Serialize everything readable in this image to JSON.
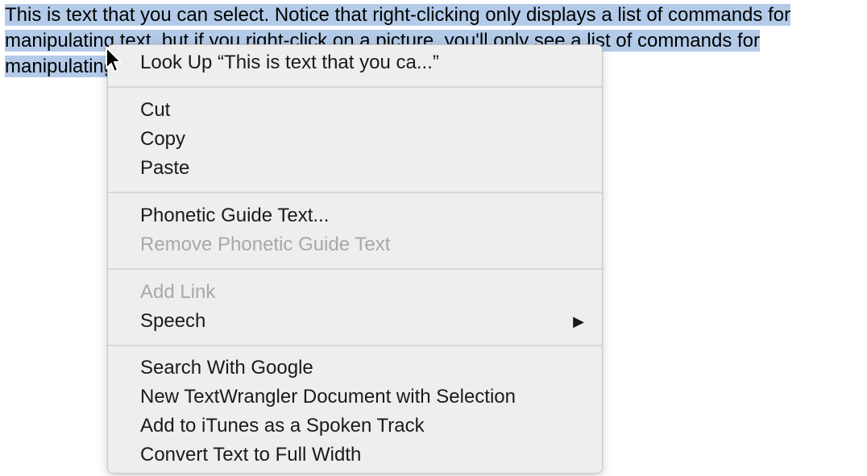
{
  "document": {
    "lines": [
      "This is text that you can select. Notice that right-clicking only displays a list of commands for",
      "manipulating text, but if you right-click on a picture, you'll only see a list of commands for",
      "manipulating"
    ]
  },
  "context_menu": {
    "look_up": "Look Up “This is text that you ca...”",
    "cut": "Cut",
    "copy": "Copy",
    "paste": "Paste",
    "phonetic_guide": "Phonetic Guide Text...",
    "remove_phonetic_guide": "Remove Phonetic Guide Text",
    "add_link": "Add Link",
    "speech": "Speech",
    "speech_arrow": "▶",
    "search_google": "Search With Google",
    "new_textwrangler": "New TextWrangler Document with Selection",
    "add_itunes": "Add to iTunes as a Spoken Track",
    "convert_full_width": "Convert Text to Full Width"
  },
  "colors": {
    "selection": "#b3cbe8",
    "menu_background": "#eeeeee",
    "disabled_text": "#a8a8a8"
  },
  "icons": {
    "pointer": "arrow-cursor-icon",
    "submenu": "triangle-right-icon"
  }
}
